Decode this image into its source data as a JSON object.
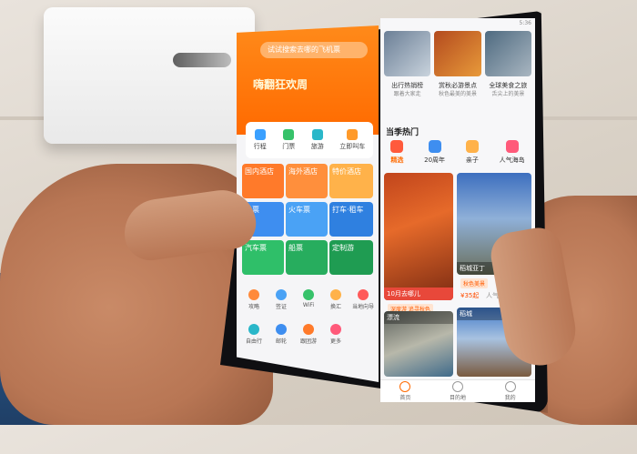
{
  "scene": {
    "description_colors": {
      "table": "#ddd5ca",
      "speaker": "#f2f2f2",
      "phone_frame": "#0f0f12",
      "accent": "#ff6a00"
    }
  },
  "left_panel": {
    "search_placeholder": "试试搜索去哪的飞机票",
    "banner_title": "嗨翻狂欢周",
    "quick_actions": [
      "行程",
      "门票",
      "旅游",
      "立即叫车"
    ],
    "tiles": [
      "国内酒店",
      "海外酒店",
      "机票",
      "火车票",
      "打车·租车",
      "汽车票",
      "船票",
      "定制游",
      "特价酒店"
    ],
    "icons": [
      "攻略",
      "签证",
      "WiFi",
      "换汇",
      "当地向导",
      "自由行",
      "邮轮",
      "跟团游",
      "更多"
    ]
  },
  "right_panel": {
    "status_time": "5:36",
    "top_captions": [
      "出行热销榜",
      "赏秋必游景点",
      "全球美食之旅"
    ],
    "top_subcaptions": [
      "跟着大家走",
      "秋色最美的美景",
      "舌尖上的美景"
    ],
    "section_title": "当季热门",
    "categories": [
      {
        "label": "精选",
        "active": true
      },
      {
        "label": "20周年",
        "active": false
      },
      {
        "label": "亲子",
        "active": false
      },
      {
        "label": "人气海岛",
        "active": false
      }
    ],
    "cards": {
      "autumn": {
        "label": "10月去哪儿",
        "tag": "深度游 追寻秋色"
      },
      "daocheng": {
        "label": "稻城亚丁",
        "tag": "秋色美景",
        "price": "¥35起",
        "note": "人气景点"
      },
      "rafting": {
        "label": "漂流"
      },
      "mountain": {
        "label": "稻城"
      }
    },
    "nav": [
      "首页",
      "目的地",
      "我的"
    ]
  }
}
